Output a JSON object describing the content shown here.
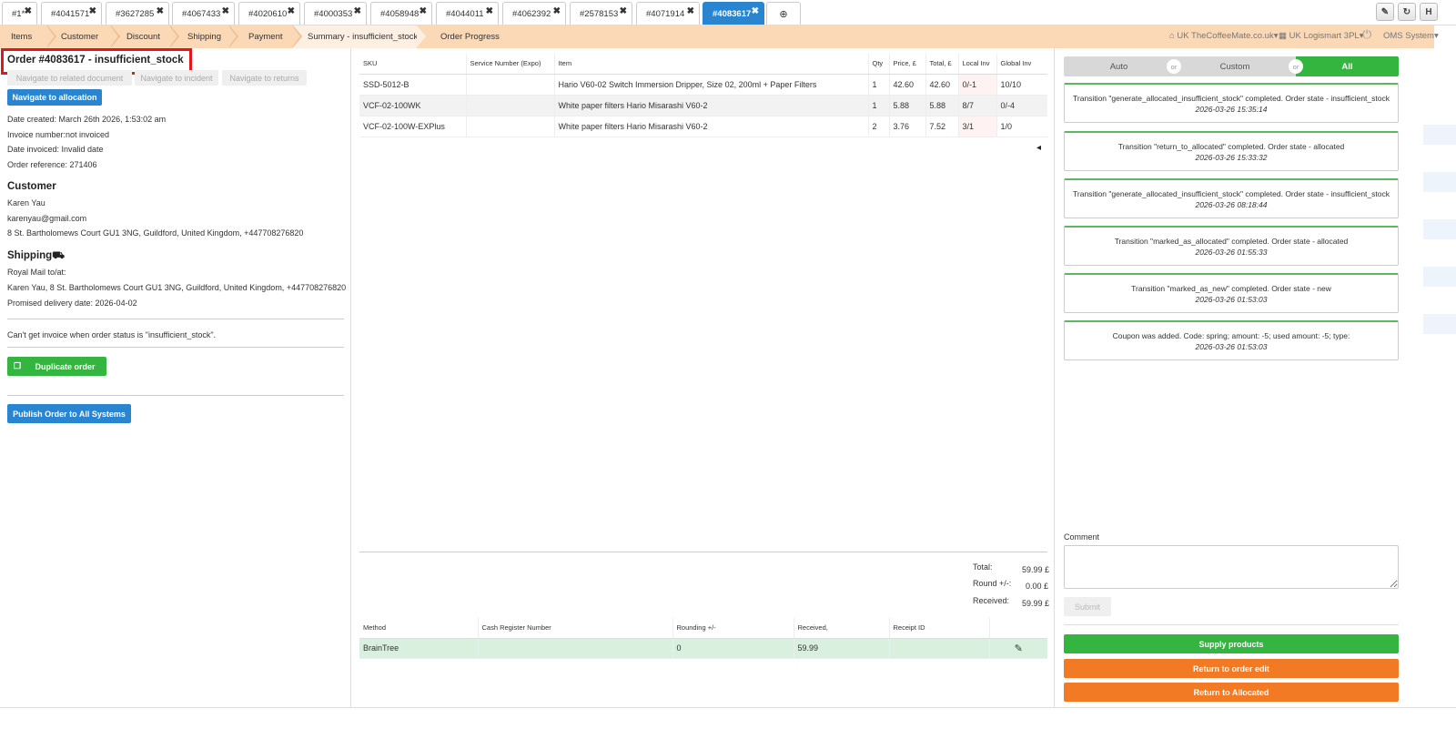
{
  "tabs": [
    {
      "label": "#1*"
    },
    {
      "label": "#4041571"
    },
    {
      "label": "#3627285"
    },
    {
      "label": "#4067433"
    },
    {
      "label": "#4020610"
    },
    {
      "label": "#4000353"
    },
    {
      "label": "#4058948"
    },
    {
      "label": "#4044011"
    },
    {
      "label": "#4062392"
    },
    {
      "label": "#2578153"
    },
    {
      "label": "#4071914"
    },
    {
      "label": "#4083617",
      "active": true
    }
  ],
  "tab_close_glyph": "✖",
  "tab_add_glyph": "⊕",
  "toolbar": {
    "tool1": "✎",
    "tool2": "↻",
    "tool3": "H"
  },
  "steps": [
    "Items",
    "Customer",
    "Discount",
    "Shipping",
    "Payment",
    "Summary - insufficient_stock",
    "Order Progress"
  ],
  "header_links": {
    "store": "UK TheCoffeeMate.co.uk",
    "warehouse": "UK Logismart 3PL",
    "system": "OMS System"
  },
  "order": {
    "title": "Order #4083617 - insufficient_stock",
    "nav_related": "Navigate to related document",
    "nav_incident": "Navigate to incident",
    "nav_returns": "Navigate to returns",
    "nav_allocation": "Navigate to allocation",
    "date_created": "Date created: March 26th 2026, 1:53:02 am",
    "invoice_number": "Invoice number:not invoiced",
    "date_invoiced": "Date invoiced: Invalid date",
    "order_reference": "Order reference: 271406"
  },
  "customer": {
    "heading": "Customer",
    "name": "Karen Yau",
    "email": "karenyau@gmail.com",
    "address": "8 St. Bartholomews Court GU1 3NG, Guildford, United Kingdom, +447708276820"
  },
  "shipping": {
    "heading": "Shipping",
    "method": "Royal Mail to/at:",
    "address": "Karen Yau, 8 St. Bartholomews Court GU1 3NG, Guildford, United Kingdom, +447708276820",
    "promised": "Promised delivery date: 2026-04-02"
  },
  "invoice_note": "Can't get invoice when order status is \"insufficient_stock\".",
  "duplicate_label": "Duplicate order",
  "publish_label": "Publish Order to All Systems",
  "items_table": {
    "headers": [
      "SKU",
      "Service Number (Expo)",
      "Item",
      "Qty",
      "Price, £",
      "Total, £",
      "Local Inv",
      "Global Inv"
    ],
    "rows": [
      {
        "sku": "SSD-5012-B",
        "service": "",
        "item": "Hario V60-02 Switch Immersion Dripper, Size 02, 200ml + Paper Filters",
        "qty": "1",
        "price": "42.60",
        "total": "42.60",
        "local": "0/-1",
        "global": "10/10"
      },
      {
        "sku": "VCF-02-100WK",
        "service": "",
        "item": "White paper filters Hario Misarashi V60-2",
        "qty": "1",
        "price": "5.88",
        "total": "5.88",
        "local": "8/7",
        "global": "0/-4"
      },
      {
        "sku": "VCF-02-100W-EXPlus",
        "service": "",
        "item": "White paper filters Hario Misarashi V60-2",
        "qty": "2",
        "price": "3.76",
        "total": "7.52",
        "local": "3/1",
        "global": "1/0"
      }
    ]
  },
  "collapse_glyph": "◂",
  "totals": {
    "total_label": "Total:",
    "total_value": "59.99 £",
    "round_label": "Round +/-:",
    "round_value": "0.00 £",
    "received_label": "Received:",
    "received_value": "59.99 £"
  },
  "payments_table": {
    "headers": [
      "Method",
      "Cash Register Number",
      "Rounding +/-",
      "Received,",
      "Receipt ID"
    ],
    "rows": [
      {
        "method": "BrainTree",
        "register": "",
        "rounding": "0",
        "received": "59.99",
        "receipt": ""
      }
    ]
  },
  "edit_glyph": "✎",
  "filter": {
    "auto": "Auto",
    "custom": "Custom",
    "all": "All",
    "or": "or"
  },
  "log": [
    {
      "message": "Transition \"generate_allocated_insufficient_stock\" completed. Order state - insufficient_stock",
      "timestamp": "2026-03-26 15:35:14"
    },
    {
      "message": "Transition \"return_to_allocated\" completed. Order state - allocated",
      "timestamp": "2026-03-26 15:33:32"
    },
    {
      "message": "Transition \"generate_allocated_insufficient_stock\" completed. Order state - insufficient_stock",
      "timestamp": "2026-03-26 08:18:44"
    },
    {
      "message": "Transition \"marked_as_allocated\" completed. Order state - allocated",
      "timestamp": "2026-03-26 01:55:33"
    },
    {
      "message": "Transition \"marked_as_new\" completed. Order state - new",
      "timestamp": "2026-03-26 01:53:03"
    },
    {
      "message": "Coupon was added. Code: spring; amount: -5; used amount: -5; type:",
      "timestamp": "2026-03-26 01:53:03"
    }
  ],
  "comment": {
    "label": "Comment",
    "value": "",
    "submit": "Submit"
  },
  "actions": {
    "supply": "Supply products",
    "return_edit": "Return to order edit",
    "return_allocated": "Return to Allocated"
  },
  "colors": {
    "accent_blue": "#2a85d0",
    "success_green": "#33b540",
    "warning_orange": "#f37a25",
    "highlight_red": "#e3161f",
    "steps_bg": "#fcd9b6"
  }
}
